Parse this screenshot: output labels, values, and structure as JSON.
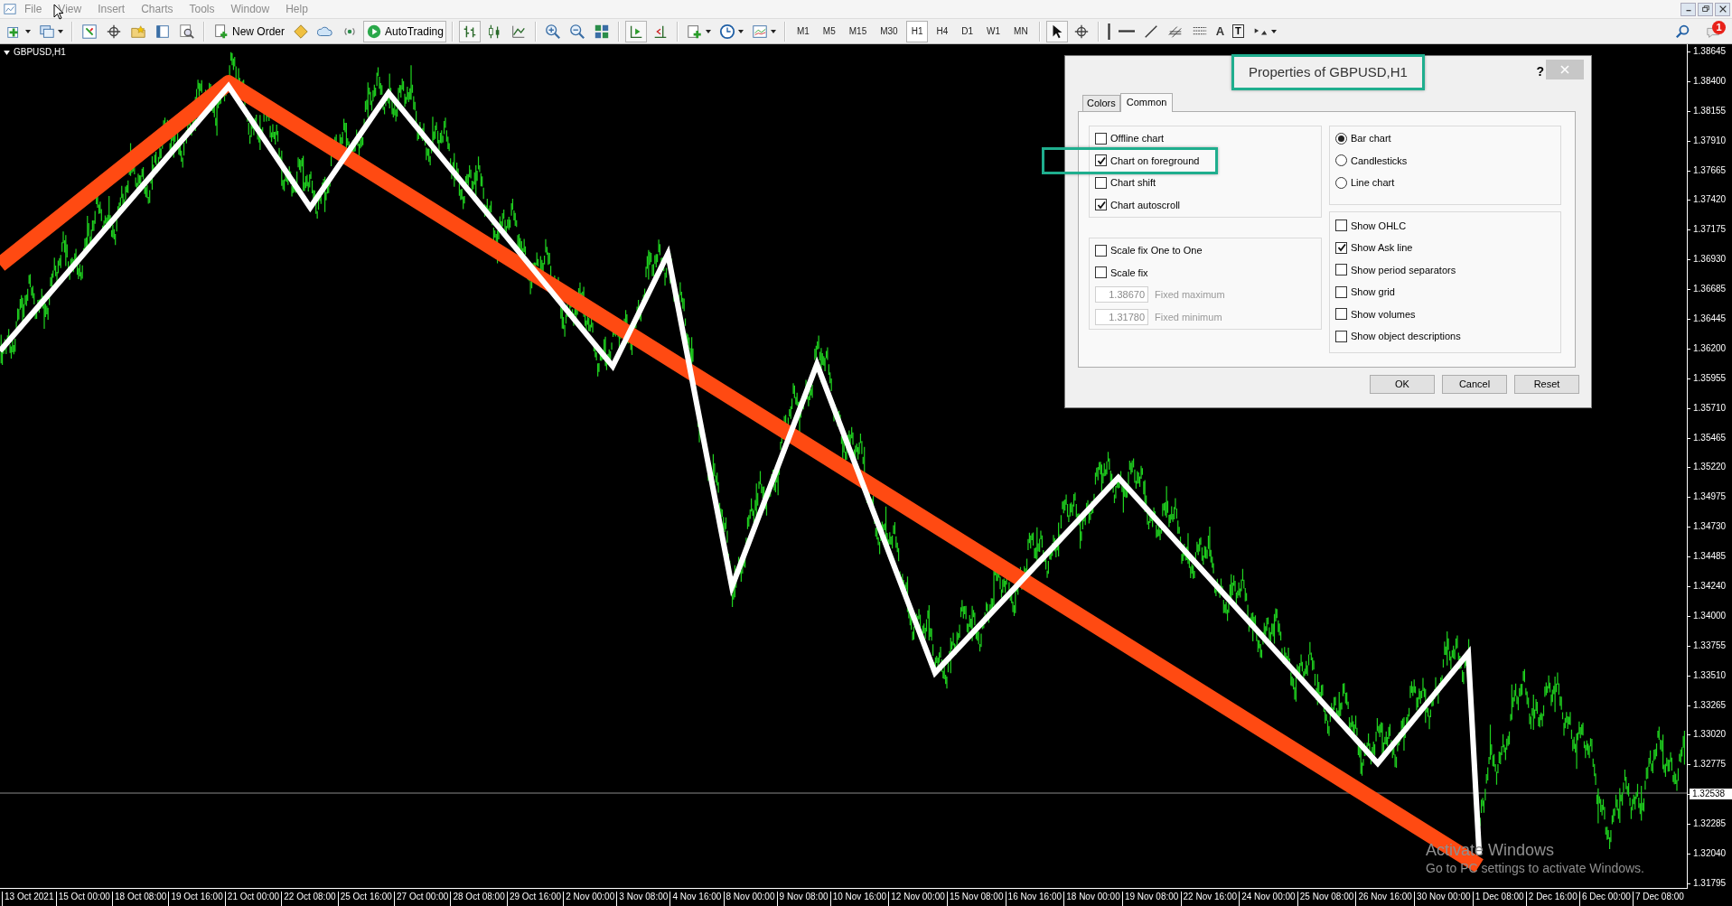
{
  "menu": [
    "File",
    "View",
    "Insert",
    "Charts",
    "Tools",
    "Window",
    "Help"
  ],
  "toolbar": {
    "new_order": "New Order",
    "autotrading": "AutoTrading",
    "timeframes": [
      {
        "label": "M1",
        "selected": false
      },
      {
        "label": "M5",
        "selected": false
      },
      {
        "label": "M15",
        "selected": false
      },
      {
        "label": "M30",
        "selected": false
      },
      {
        "label": "H1",
        "selected": true
      },
      {
        "label": "H4",
        "selected": false
      },
      {
        "label": "D1",
        "selected": false
      },
      {
        "label": "W1",
        "selected": false
      },
      {
        "label": "MN",
        "selected": false
      }
    ],
    "text_tool": "A",
    "label_tool": "T",
    "notifications": "1"
  },
  "chart": {
    "title": "GBPUSD,H1",
    "price_axis": [
      {
        "label": "1.38645",
        "kind": "tick"
      },
      {
        "label": "1.38400",
        "kind": "tick"
      },
      {
        "label": "1.38155",
        "kind": "tick"
      },
      {
        "label": "1.37910",
        "kind": "tick"
      },
      {
        "label": "1.37665",
        "kind": "tick"
      },
      {
        "label": "1.37420",
        "kind": "tick"
      },
      {
        "label": "1.37175",
        "kind": "tick"
      },
      {
        "label": "1.36930",
        "kind": "tick"
      },
      {
        "label": "1.36685",
        "kind": "tick"
      },
      {
        "label": "1.36445",
        "kind": "tick"
      },
      {
        "label": "1.36200",
        "kind": "tick"
      },
      {
        "label": "1.35955",
        "kind": "tick"
      },
      {
        "label": "1.35710",
        "kind": "tick"
      },
      {
        "label": "1.35465",
        "kind": "tick"
      },
      {
        "label": "1.35220",
        "kind": "tick"
      },
      {
        "label": "1.34975",
        "kind": "tick"
      },
      {
        "label": "1.34730",
        "kind": "tick"
      },
      {
        "label": "1.34485",
        "kind": "tick"
      },
      {
        "label": "1.34240",
        "kind": "tick"
      },
      {
        "label": "1.34000",
        "kind": "tick"
      },
      {
        "label": "1.33755",
        "kind": "tick"
      },
      {
        "label": "1.33510",
        "kind": "tick"
      },
      {
        "label": "1.33265",
        "kind": "tick"
      },
      {
        "label": "1.33020",
        "kind": "tick"
      },
      {
        "label": "1.32775",
        "kind": "tick"
      },
      {
        "label": "1.32538",
        "kind": "current"
      },
      {
        "label": "1.32285",
        "kind": "tick"
      },
      {
        "label": "1.32040",
        "kind": "tick"
      },
      {
        "label": "1.31795",
        "kind": "tick"
      }
    ],
    "time_axis": [
      "13 Oct 2021",
      "15 Oct 00:00",
      "18 Oct 08:00",
      "19 Oct 16:00",
      "21 Oct 00:00",
      "22 Oct 08:00",
      "25 Oct 16:00",
      "27 Oct 00:00",
      "28 Oct 08:00",
      "29 Oct 16:00",
      "2 Nov 00:00",
      "3 Nov 08:00",
      "4 Nov 16:00",
      "8 Nov 00:00",
      "9 Nov 08:00",
      "10 Nov 16:00",
      "12 Nov 00:00",
      "15 Nov 08:00",
      "16 Nov 16:00",
      "18 Nov 00:00",
      "19 Nov 08:00",
      "22 Nov 16:00",
      "24 Nov 00:00",
      "25 Nov 08:00",
      "26 Nov 16:00",
      "30 Nov 00:00",
      "1 Dec 08:00",
      "2 Dec 16:00",
      "6 Dec 00:00",
      "7 Dec 08:00"
    ]
  },
  "dialog": {
    "title": "Properties of GBPUSD,H1",
    "help": "?",
    "tabs": [
      {
        "label": "Colors",
        "selected": false
      },
      {
        "label": "Common",
        "selected": true
      }
    ],
    "chart_options": [
      {
        "label": "Offline chart",
        "checked": false
      },
      {
        "label": "Chart on foreground",
        "checked": true
      },
      {
        "label": "Chart shift",
        "checked": false
      },
      {
        "label": "Chart autoscroll",
        "checked": true
      }
    ],
    "scale_options": [
      {
        "label": "Scale fix One to One",
        "checked": false
      },
      {
        "label": "Scale fix",
        "checked": false
      }
    ],
    "fixed_fields": [
      {
        "value": "1.38670",
        "label": "Fixed maximum",
        "disabled": true
      },
      {
        "value": "1.31780",
        "label": "Fixed minimum",
        "disabled": true
      }
    ],
    "chart_types": [
      {
        "label": "Bar chart",
        "selected": true
      },
      {
        "label": "Candlesticks",
        "selected": false
      },
      {
        "label": "Line chart",
        "selected": false
      }
    ],
    "show_options": [
      {
        "label": "Show OHLC",
        "checked": false
      },
      {
        "label": "Show Ask line",
        "checked": true
      },
      {
        "label": "Show period separators",
        "checked": false
      },
      {
        "label": "Show grid",
        "checked": false
      },
      {
        "label": "Show volumes",
        "checked": false
      },
      {
        "label": "Show object descriptions",
        "checked": false
      }
    ],
    "buttons": [
      "OK",
      "Cancel",
      "Reset"
    ]
  },
  "os_notice": {
    "title": "Activate Windows",
    "text": "Go to PC settings to activate Windows."
  }
}
